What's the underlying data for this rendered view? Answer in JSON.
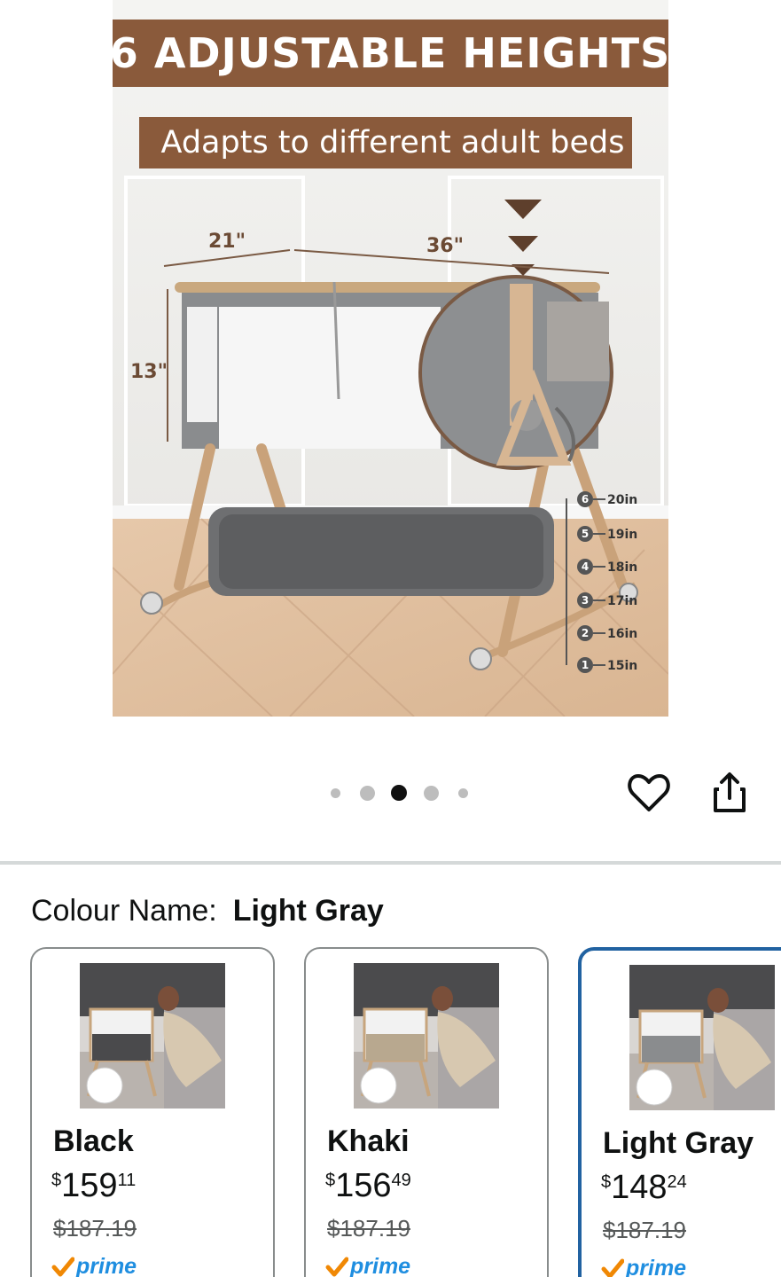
{
  "product_image": {
    "headline": "6 ADJUSTABLE HEIGHTS",
    "subheadline": "Adapts to different adult beds",
    "dimensions": {
      "width": "21\"",
      "length": "36\"",
      "depth": "13\""
    },
    "height_levels": [
      {
        "num": "6",
        "label": "20in"
      },
      {
        "num": "5",
        "label": "19in"
      },
      {
        "num": "4",
        "label": "18in"
      },
      {
        "num": "3",
        "label": "17in"
      },
      {
        "num": "2",
        "label": "16in"
      },
      {
        "num": "1",
        "label": "15in"
      }
    ],
    "colors": {
      "banner": "#8a5a3b",
      "dimension_text": "#6b4a34"
    }
  },
  "carousel": {
    "total_images": 5,
    "active_index": 2
  },
  "actions": {
    "favorite_icon": "heart-icon",
    "share_icon": "share-icon"
  },
  "colour": {
    "label": "Colour Name:",
    "selected": "Light Gray",
    "options": [
      {
        "name": "Black",
        "currency": "$",
        "whole": "159",
        "fraction": "11",
        "list_price": "$187.19",
        "prime": "prime",
        "selected": false
      },
      {
        "name": "Khaki",
        "currency": "$",
        "whole": "156",
        "fraction": "49",
        "list_price": "$187.19",
        "prime": "prime",
        "selected": false
      },
      {
        "name": "Light Gray",
        "currency": "$",
        "whole": "148",
        "fraction": "24",
        "list_price": "$187.19",
        "prime": "prime",
        "selected": true
      }
    ]
  },
  "theme": {
    "accent_selected": "#2162a1",
    "prime_blue": "#1f8ee0",
    "prime_check": "#f08804"
  }
}
